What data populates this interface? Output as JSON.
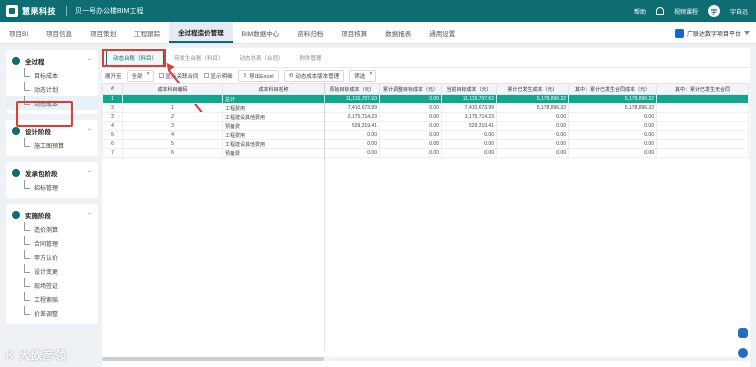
{
  "header": {
    "brand": "慧果科技",
    "project": "贝一号办公楼BIM工程",
    "help": "帮助",
    "course": "视频课程",
    "user": "宇自远",
    "avatar_text": "宇",
    "bg_color": "#0d6d73"
  },
  "nav": {
    "items": [
      {
        "label": "项目BI",
        "active": false
      },
      {
        "label": "项目信息",
        "active": false
      },
      {
        "label": "项目策划",
        "active": false
      },
      {
        "label": "工程跟踪",
        "active": false
      },
      {
        "label": "全过程造价管理",
        "active": true
      },
      {
        "label": "BIM数据中心",
        "active": false
      },
      {
        "label": "资料归档",
        "active": false
      },
      {
        "label": "项目核算",
        "active": false
      },
      {
        "label": "数据报表",
        "active": false
      },
      {
        "label": "通用设置",
        "active": false
      }
    ],
    "brand_right": "广联达数字项目平台"
  },
  "sidebar": {
    "groups": [
      {
        "title": "全过程",
        "items": [
          {
            "label": "目标成本",
            "active": false
          },
          {
            "label": "动态计划",
            "active": false
          },
          {
            "label": "动态成本",
            "active": true
          }
        ]
      },
      {
        "title": "设计阶段",
        "items": [
          {
            "label": "施工图预算",
            "active": false
          }
        ]
      },
      {
        "title": "发承包阶段",
        "items": [
          {
            "label": "招标管理",
            "active": false
          }
        ]
      },
      {
        "title": "实施阶段",
        "items": [
          {
            "label": "造价测算",
            "active": false
          },
          {
            "label": "合同管理",
            "active": false
          },
          {
            "label": "甲方认价",
            "active": false
          },
          {
            "label": "设计变更",
            "active": false
          },
          {
            "label": "现场签证",
            "active": false
          },
          {
            "label": "工程索赔",
            "active": false
          },
          {
            "label": "价差调整",
            "active": false
          }
        ]
      }
    ]
  },
  "subtabs": [
    {
      "label": "动态台账（科目）",
      "active": true
    },
    {
      "label": "待发生台账（科目）",
      "active": false
    },
    {
      "label": "动态总表（合同）",
      "active": false
    },
    {
      "label": "附件管理",
      "active": false
    }
  ],
  "toolbar": {
    "expand_label": "展开至",
    "expand_value": "全部",
    "check_contract": "显示关联合同",
    "check_detail": "显示明细",
    "export_btn": "导出Excel",
    "version_btn": "动态成本版本管理",
    "filter_btn": "筛选"
  },
  "table": {
    "headers": [
      "#",
      "成本科目编码",
      "成本科目名称",
      "原始目标成本（元）",
      "累计调整目标成本（元）",
      "当前目标成本（元）",
      "累计已发生成本（元）",
      "其中：累计已发生合同成本（元）",
      "其中：累计已发生无合同"
    ],
    "rows": [
      {
        "n": "1",
        "code": "",
        "name": "总计",
        "v1": "11,115,707.63",
        "v2": "0.00",
        "v3": "11,115,707.63",
        "v4": "5,178,896.32",
        "v5": "5,178,896.32",
        "v6": "",
        "selected": true
      },
      {
        "n": "2",
        "code": "1",
        "name": "工程费用",
        "v1": "7,410,673.99",
        "v2": "0.00",
        "v3": "7,410,673.99",
        "v4": "5,178,896.32",
        "v5": "5,178,896.32",
        "v6": "",
        "selected": false
      },
      {
        "n": "3",
        "code": "2",
        "name": "工程建设其他费用",
        "v1": "3,175,714.23",
        "v2": "0.00",
        "v3": "3,175,714.23",
        "v4": "0.00",
        "v5": "0.00",
        "v6": "",
        "selected": false
      },
      {
        "n": "4",
        "code": "3",
        "name": "预备费",
        "v1": "529,319.41",
        "v2": "0.00",
        "v3": "529,319.41",
        "v4": "0.00",
        "v5": "0.00",
        "v6": "",
        "selected": false
      },
      {
        "n": "5",
        "code": "4",
        "name": "工程费用",
        "v1": "0.00",
        "v2": "0.00",
        "v3": "0.00",
        "v4": "0.00",
        "v5": "0.00",
        "v6": "",
        "selected": false
      },
      {
        "n": "6",
        "code": "5",
        "name": "工程建设其他费用",
        "v1": "0.00",
        "v2": "0.00",
        "v3": "0.00",
        "v4": "0.00",
        "v5": "0.00",
        "v6": "",
        "selected": false
      },
      {
        "n": "7",
        "code": "6",
        "name": "预备费",
        "v1": "0.00",
        "v2": "0.00",
        "v3": "0.00",
        "v4": "0.00",
        "v5": "0.00",
        "v6": "",
        "selected": false
      }
    ]
  },
  "watermark": "K 大欧彦领"
}
